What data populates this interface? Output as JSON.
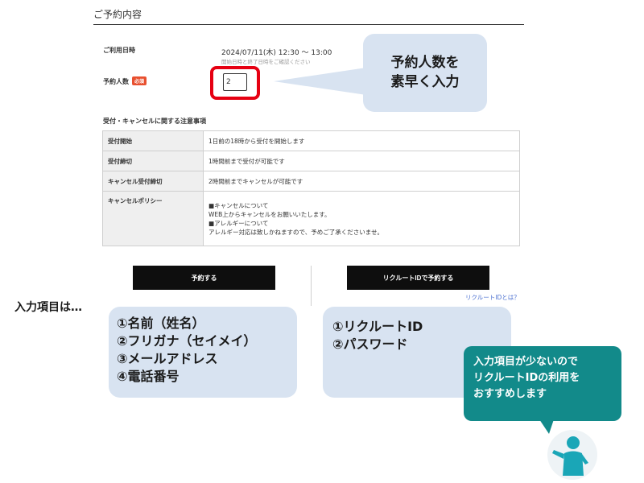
{
  "reservation": {
    "section_title": "ご予約内容",
    "datetime_label": "ご利用日時",
    "datetime_value": "2024/07/11(木) 12:30 〜 13:00",
    "datetime_hint": "開始日時と終了日時をご確認ください",
    "people_label": "予約人数",
    "required_badge": "必須",
    "people_value": "2"
  },
  "callout_top": {
    "line1": "予約人数を",
    "line2": "素早く入力"
  },
  "notes": {
    "heading": "受付・キャンセルに関する注意事項",
    "rows": [
      {
        "label": "受付開始",
        "value": "1日前の18時から受付を開始します"
      },
      {
        "label": "受付締切",
        "value": "1時間前まで受付が可能です"
      },
      {
        "label": "キャンセル受付締切",
        "value": "2時間前までキャンセルが可能です"
      }
    ],
    "policy_label": "キャンセルポリシー",
    "policy_lines": [
      "■キャンセルについて",
      "WEB上からキャンセルをお願いいたします。",
      "■アレルギーについて",
      "アレルギー対応は致しかねますので、予めご了承くださいませ。"
    ]
  },
  "actions": {
    "reserve_button": "予約する",
    "recruit_button": "リクルートIDで予約する",
    "recruit_link": "リクルートIDとは？"
  },
  "annotation": {
    "intro_label": "入力項目は…",
    "left_items": [
      "①名前（姓名）",
      "②フリガナ（セイメイ）",
      "③メールアドレス",
      "④電話番号"
    ],
    "right_items": [
      "①リクルートID",
      "②パスワード"
    ],
    "bubble_lines": [
      "入力項目が少ないので",
      "リクルートIDの利用を",
      "おすすめします"
    ]
  },
  "icons": {
    "avatar": "person-pointing-icon"
  },
  "colors": {
    "highlight_red": "#e60012",
    "callout_blue": "#d8e3f1",
    "bubble_teal": "#128a8a",
    "badge_orange": "#e8502f",
    "button_dark": "#0e0e0e",
    "avatar_teal": "#1aa6b7"
  }
}
